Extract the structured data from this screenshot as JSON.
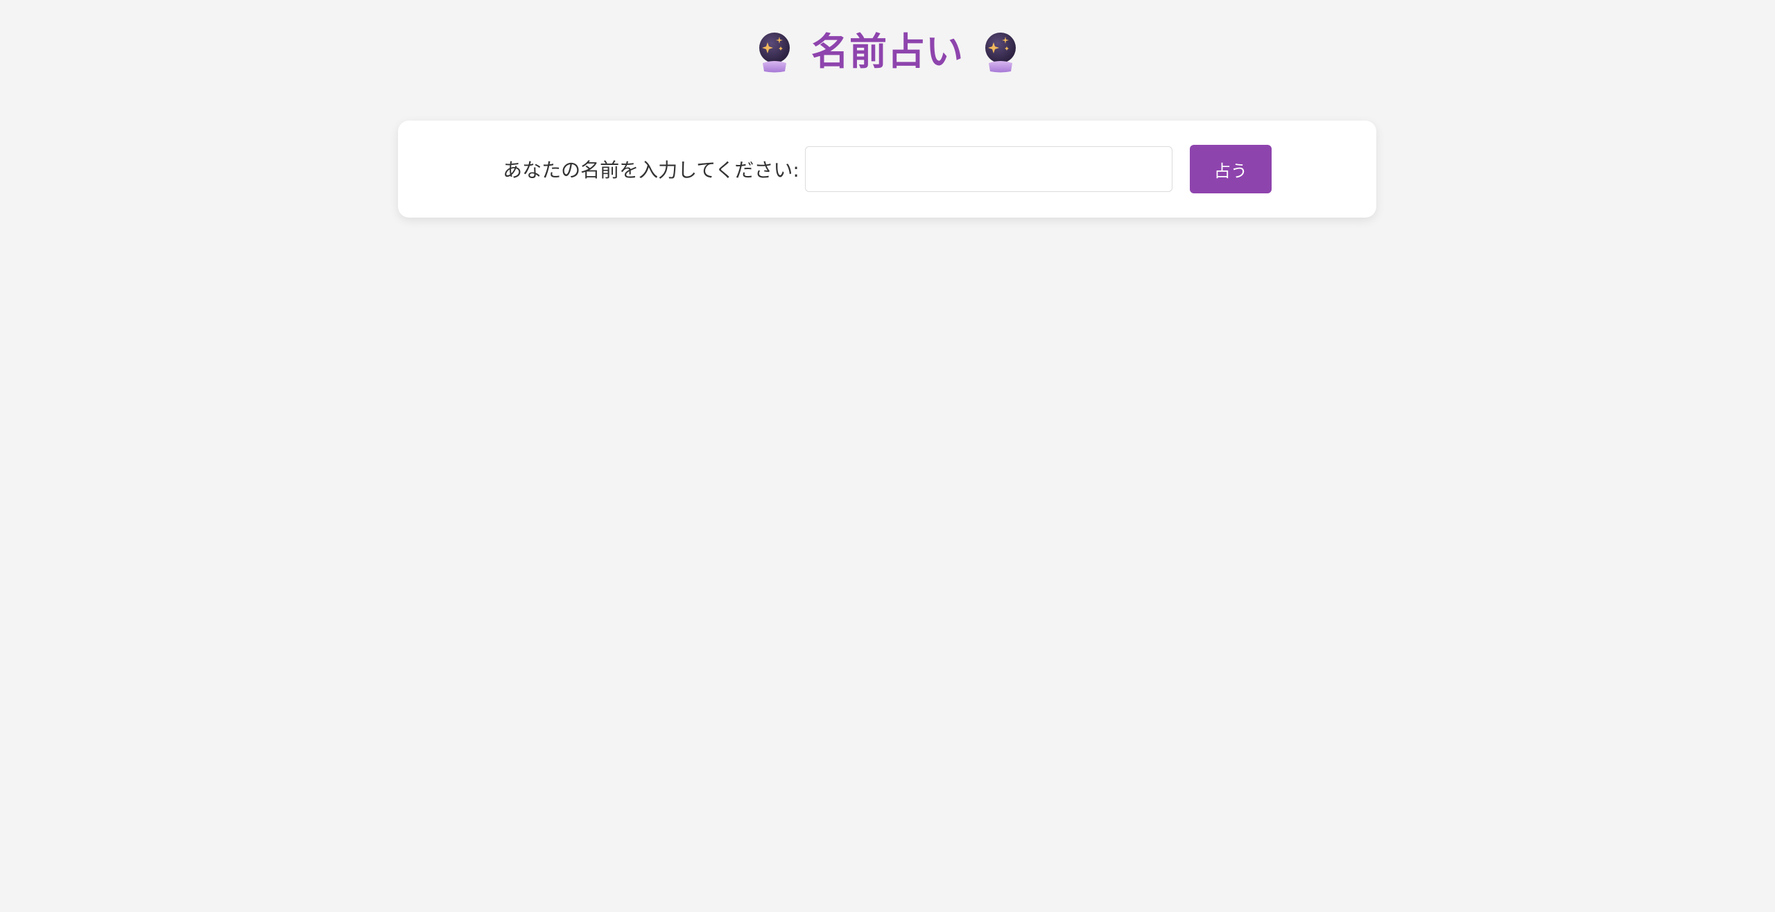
{
  "header": {
    "title": "名前占い",
    "left_icon": "crystal-ball-icon",
    "right_icon": "crystal-ball-icon"
  },
  "form": {
    "label": "あなたの名前を入力してください:",
    "input_value": "",
    "input_placeholder": "",
    "submit_label": "占う"
  },
  "colors": {
    "accent": "#8e44ad",
    "background": "#f4f4f4",
    "card": "#ffffff",
    "text": "#333333"
  }
}
